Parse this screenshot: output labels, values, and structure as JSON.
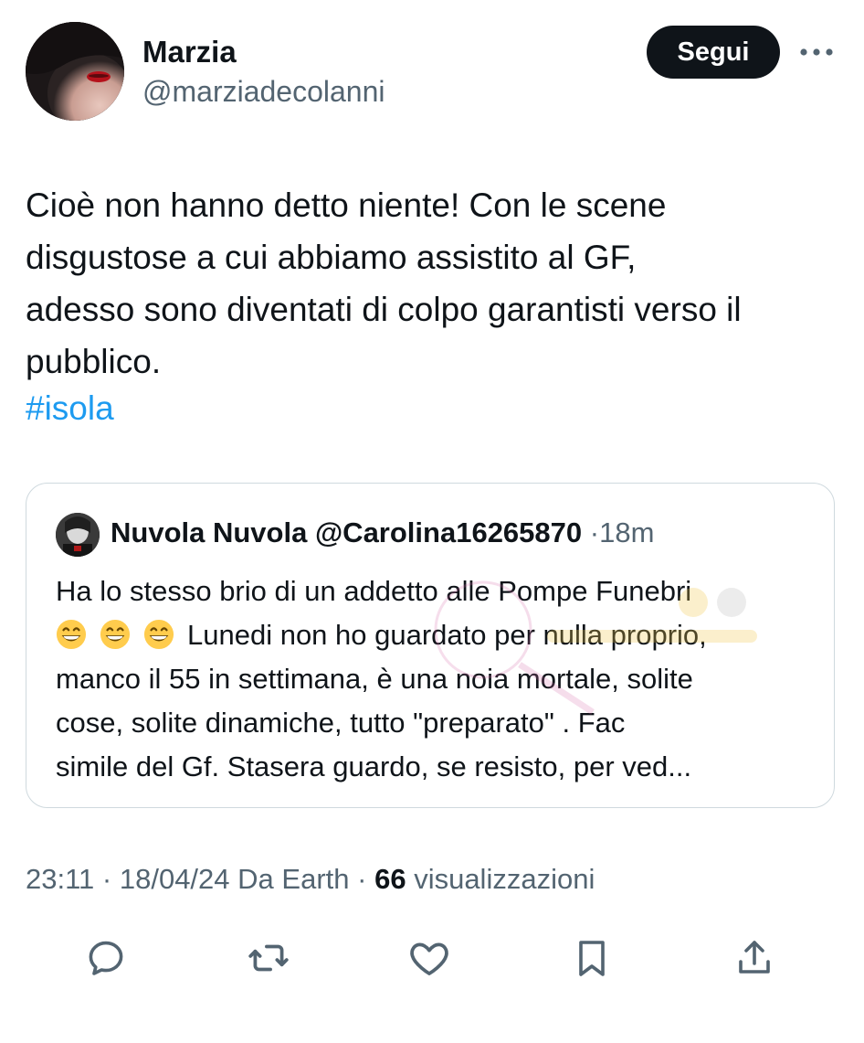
{
  "tweet": {
    "author": {
      "display_name": "Marzia",
      "handle": "@marziadecolanni"
    },
    "follow_label": "Segui",
    "text_lines": [
      "Cioè non hanno detto niente! Con le scene",
      "disgustose a cui abbiamo assistito al GF,",
      "adesso sono diventati di colpo garantisti verso il",
      "pubblico."
    ],
    "hashtag": "#isola",
    "quote": {
      "display_name": "Nuvola Nuvola",
      "handle": "@Carolina16265870",
      "separator": "·",
      "time": "18m",
      "lines": [
        "Ha lo stesso brio di un addetto alle Pompe Funebri",
        "Lunedi non ho guardato per nulla proprio,",
        "manco il 55 in settimana, è una noia mortale, solite",
        "cose, solite dinamiche, tutto \"preparato\" . Fac",
        "simile del Gf.  Stasera guardo, se resisto, per ved..."
      ],
      "emoji": "grinning-face-with-smiling-eyes",
      "emoji_count": 3
    },
    "meta": {
      "time": "23:11",
      "sep1": "·",
      "date": "18/04/24",
      "source": "Da Earth",
      "sep2": "·",
      "views": "66",
      "views_label": "visualizzazioni"
    },
    "actions": [
      "reply",
      "retweet",
      "like",
      "bookmark",
      "share"
    ],
    "colors": {
      "text": "#0f1419",
      "secondary": "#536471",
      "link": "#1d9bf0",
      "border": "#cfd9de",
      "button_bg": "#0f1419"
    }
  }
}
